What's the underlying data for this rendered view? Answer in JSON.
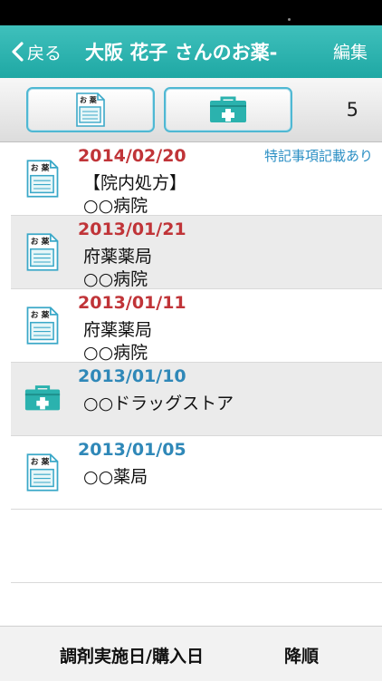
{
  "nav": {
    "back_label": "戻る",
    "title": "大阪 花子 さんのお薬-",
    "edit_label": "編集"
  },
  "toolbar": {
    "left_icon": "medicine-notebook-icon",
    "right_icon": "first-aid-kit-icon",
    "count": "5"
  },
  "records": [
    {
      "date": "2014/02/20",
      "line1": "【院内処方】",
      "line2": "○○病院",
      "note": "特記事項記載あり",
      "type": "prescription",
      "date_color": "#c03438"
    },
    {
      "date": "2013/01/21",
      "line1": "府薬薬局",
      "line2": "○○病院",
      "note": "",
      "type": "prescription",
      "date_color": "#c03438"
    },
    {
      "date": "2013/01/11",
      "line1": "府薬薬局",
      "line2": "○○病院",
      "note": "",
      "type": "prescription",
      "date_color": "#c03438"
    },
    {
      "date": "2013/01/10",
      "line1": "○○ドラッグストア",
      "line2": "",
      "note": "",
      "type": "otc",
      "date_color": "#2f88b8"
    },
    {
      "date": "2013/01/05",
      "line1": "○○薬局",
      "line2": "",
      "note": "",
      "type": "prescription",
      "date_color": "#2f88b8"
    }
  ],
  "footer": {
    "sort_label": "調剤実施日/購入日",
    "order_label": "降順"
  },
  "colors": {
    "accent": "#2bb2ae",
    "prescription_date": "#c03438",
    "otc_date": "#2f88b8"
  }
}
